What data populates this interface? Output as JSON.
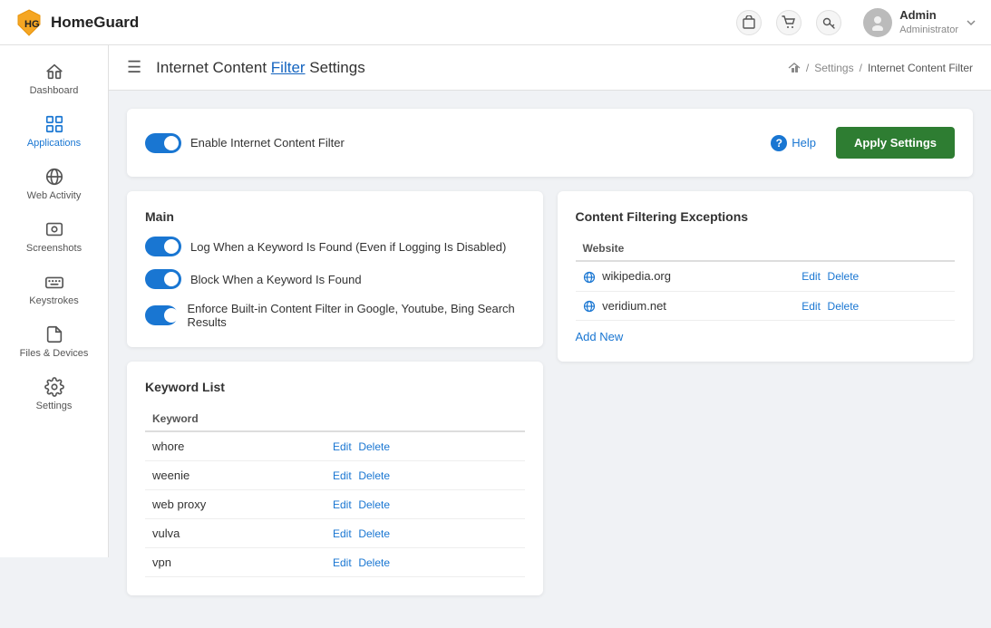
{
  "app": {
    "name": "HomeGuard"
  },
  "topbar": {
    "icons": [
      "store-icon",
      "cart-icon",
      "key-icon"
    ],
    "user": {
      "name": "Admin",
      "role": "Administrator"
    }
  },
  "sidebar": {
    "items": [
      {
        "id": "dashboard",
        "label": "Dashboard",
        "icon": "home-icon"
      },
      {
        "id": "applications",
        "label": "Applications",
        "icon": "applications-icon"
      },
      {
        "id": "web-activity",
        "label": "Web Activity",
        "icon": "web-activity-icon"
      },
      {
        "id": "screenshots",
        "label": "Screenshots",
        "icon": "screenshots-icon"
      },
      {
        "id": "keystrokes",
        "label": "Keystrokes",
        "icon": "keystrokes-icon"
      },
      {
        "id": "files-devices",
        "label": "Files & Devices",
        "icon": "files-icon"
      },
      {
        "id": "settings",
        "label": "Settings",
        "icon": "settings-icon"
      }
    ]
  },
  "page": {
    "title_prefix": "Internet Content ",
    "title_highlight": "Filter",
    "title_suffix": " Settings",
    "full_title": "Internet Content Filter Settings",
    "breadcrumbs": [
      {
        "label": "Settings",
        "link": true
      },
      {
        "label": "Internet Content Filter",
        "link": false
      }
    ]
  },
  "filter_card": {
    "enable_label": "Enable Internet Content Filter",
    "help_label": "Help",
    "apply_label": "Apply Settings"
  },
  "main_section": {
    "title": "Main",
    "toggles": [
      {
        "id": "log-keyword",
        "label": "Log When a Keyword Is Found (Even if Logging Is Disabled)",
        "on": true
      },
      {
        "id": "block-keyword",
        "label": "Block When a Keyword Is Found",
        "on": true
      },
      {
        "id": "enforce-filter",
        "label": "Enforce Built-in Content Filter in Google, Youtube, Bing Search Results",
        "on": true
      }
    ]
  },
  "keyword_list": {
    "title": "Keyword List",
    "column_header": "Keyword",
    "keywords": [
      {
        "word": "whore",
        "edit": "Edit",
        "delete": "Delete"
      },
      {
        "word": "weenie",
        "edit": "Edit",
        "delete": "Delete"
      },
      {
        "word": "web proxy",
        "edit": "Edit",
        "delete": "Delete"
      },
      {
        "word": "vulva",
        "edit": "Edit",
        "delete": "Delete"
      },
      {
        "word": "vpn",
        "edit": "Edit",
        "delete": "Delete"
      }
    ]
  },
  "exceptions_section": {
    "title": "Content Filtering Exceptions",
    "column_header": "Website",
    "websites": [
      {
        "url": "wikipedia.org",
        "edit": "Edit",
        "delete": "Delete"
      },
      {
        "url": "veridium.net",
        "edit": "Edit",
        "delete": "Delete"
      }
    ],
    "add_new_label": "Add New"
  }
}
